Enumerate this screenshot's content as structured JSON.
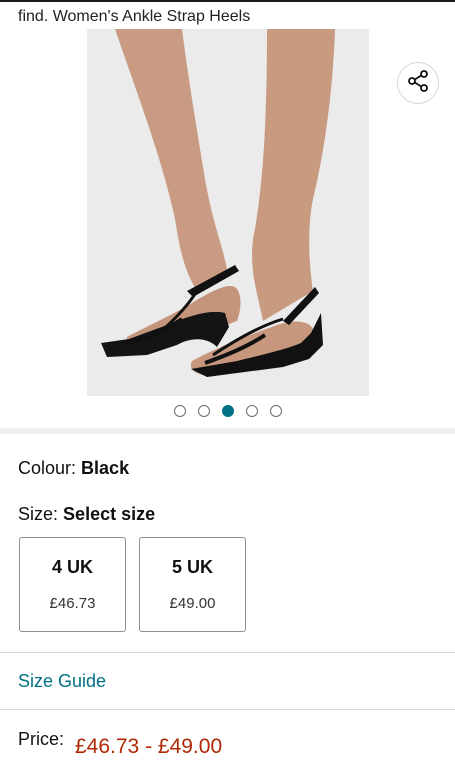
{
  "product": {
    "title": "find. Women's Ankle Strap Heels"
  },
  "gallery": {
    "image_description": "black strappy wedge sandals",
    "dot_count": 5,
    "active_index": 2
  },
  "colour": {
    "label": "Colour:",
    "value": "Black"
  },
  "size": {
    "label": "Size:",
    "value": "Select size",
    "options": [
      {
        "label": "4 UK",
        "price": "£46.73"
      },
      {
        "label": "5 UK",
        "price": "£49.00"
      }
    ]
  },
  "size_guide": {
    "label": "Size Guide"
  },
  "price": {
    "label": "Price:",
    "range": "£46.73 - £49.00"
  },
  "colors": {
    "link": "#007185",
    "price": "#b12704",
    "active_dot": "#007185"
  },
  "icons": {
    "share": "share-icon"
  }
}
